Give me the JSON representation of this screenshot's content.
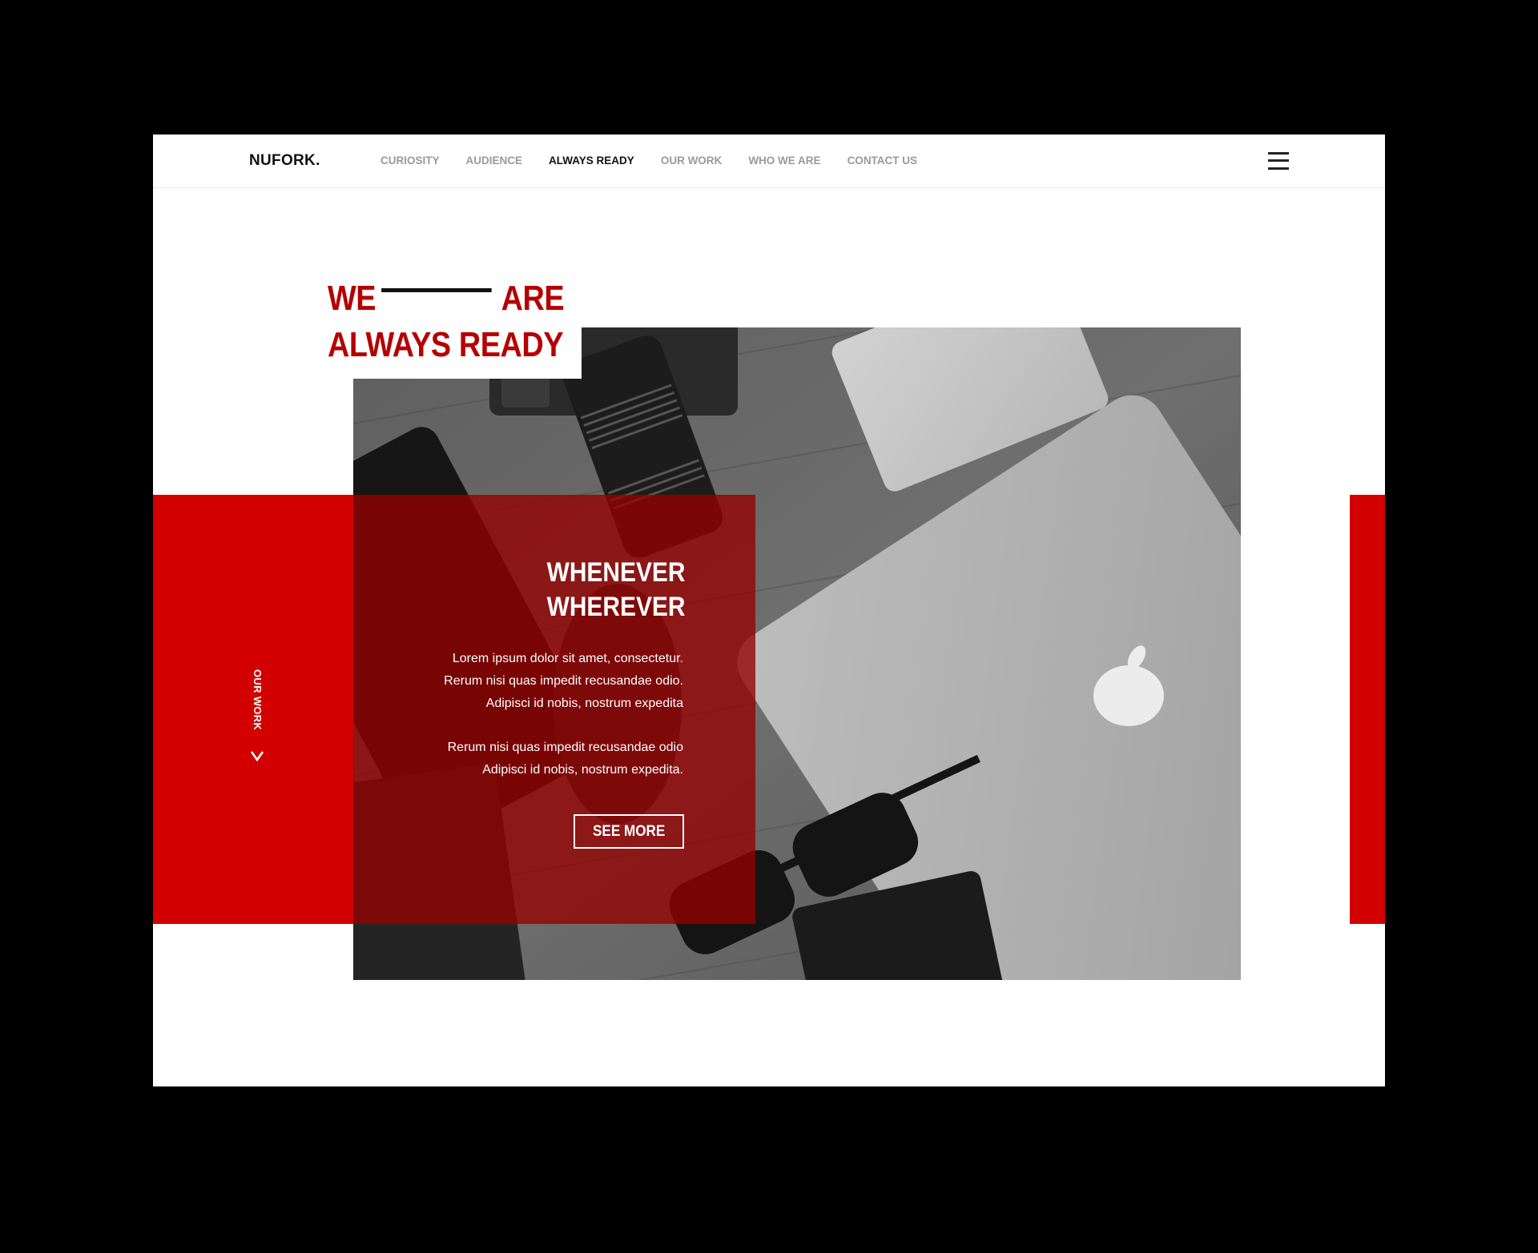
{
  "brand": {
    "logo": "NUFORK."
  },
  "nav": {
    "items": [
      {
        "label": "CURIOSITY",
        "active": false
      },
      {
        "label": "AUDIENCE",
        "active": false
      },
      {
        "label": "ALWAYS READY",
        "active": true
      },
      {
        "label": "OUR WORK",
        "active": false
      },
      {
        "label": "WHO WE ARE",
        "active": false
      },
      {
        "label": "CONTACT US",
        "active": false
      }
    ],
    "menu_icon": "hamburger-menu-icon"
  },
  "hero": {
    "headline_word_1": "WE",
    "headline_word_2": "ARE",
    "headline_line_2": "ALWAYS READY",
    "card_title_line_1": "WHENEVER",
    "card_title_line_2": "WHEREVER",
    "paragraph_1": [
      "Lorem ipsum dolor sit amet, consectetur.",
      "Rerum nisi quas impedit recusandae odio.",
      "Adipisci id nobis, nostrum expedita"
    ],
    "paragraph_2": [
      "Rerum nisi quas impedit recusandae odio",
      "Adipisci id nobis, nostrum expedita."
    ],
    "cta_label": "SEE MORE"
  },
  "side_nav": {
    "label": "OUR WORK",
    "arrow_icon": "chevron-down-icon"
  },
  "colors": {
    "accent_red": "#d20000",
    "headline_red": "#b50000",
    "card_overlay": "rgba(150,0,0,0.78)"
  }
}
